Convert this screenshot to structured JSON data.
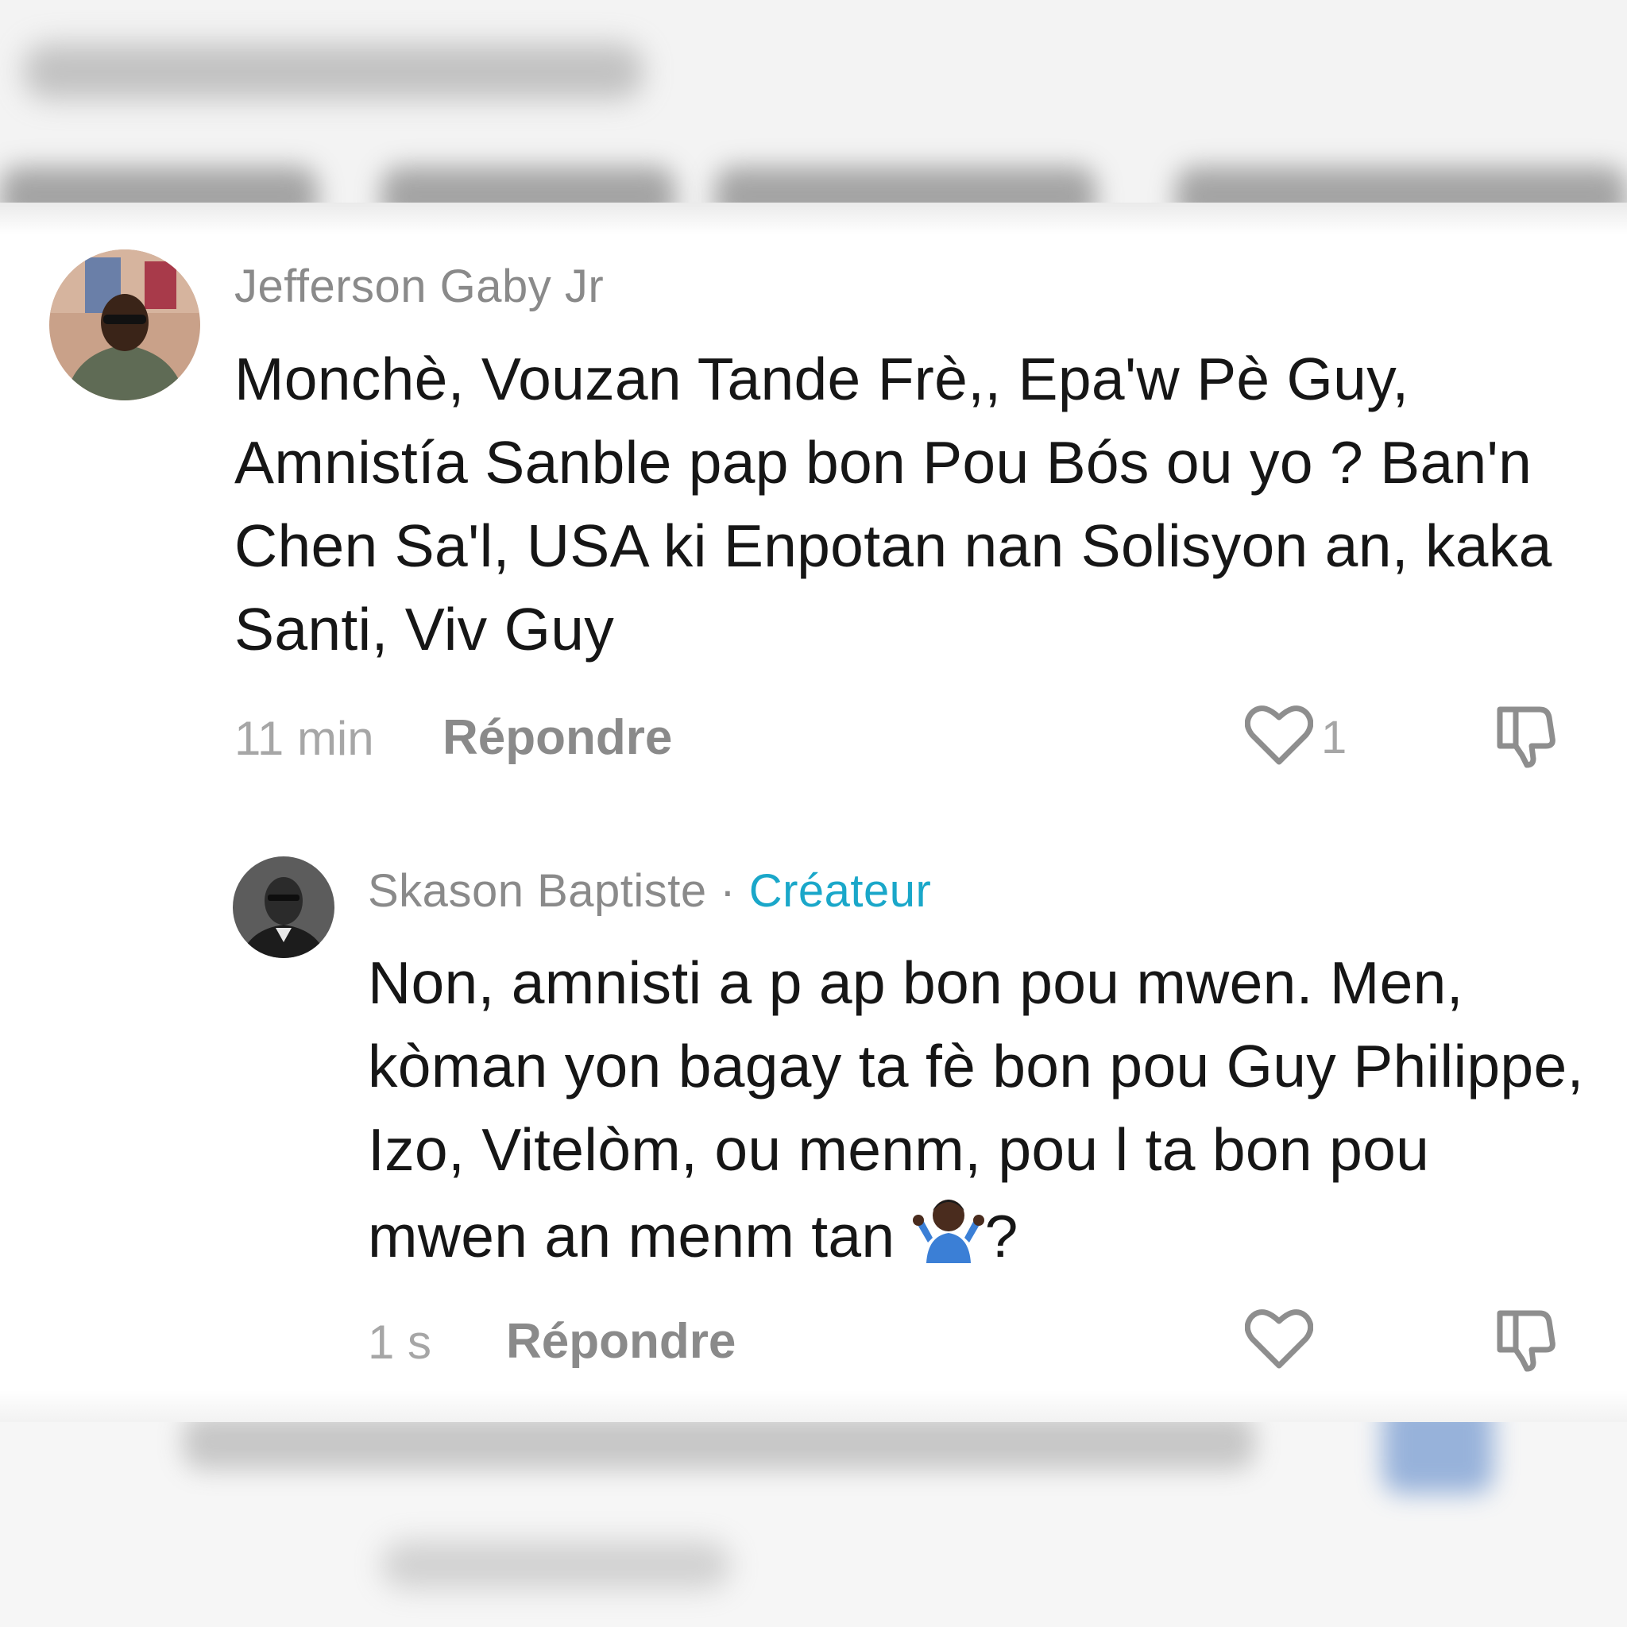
{
  "comments": [
    {
      "username": "Jefferson Gaby Jr",
      "text": "Monchè, Vouzan Tande Frè,, Epa'w Pè Guy, Amnistía Sanble pap bon Pou Bós ou yo ? Ban'n Chen Sa'l, USA ki Enpotan nan Solisyon an, kaka Santi, Viv Guy",
      "time": "11 min",
      "reply_label": "Répondre",
      "like_count": "1"
    },
    {
      "username": "Skason Baptiste",
      "separator": "·",
      "badge": "Créateur",
      "text": "Non, amnisti a p ap bon pou mwen. Men, kòman yon bagay ta fè bon pou Guy Philippe, Izo, Vitelòm, ou menm, pou l ta bon pou mwen an menm tan",
      "text_suffix": "?",
      "emoji": "person-shrugging-emoji",
      "time": "1 s",
      "reply_label": "Répondre"
    }
  ],
  "icons": {
    "like": "heart-outline-icon",
    "dislike": "thumbs-down-icon"
  },
  "colors": {
    "creator_badge": "#1aa7c9",
    "username": "#8a8a8a",
    "text": "#161616"
  }
}
